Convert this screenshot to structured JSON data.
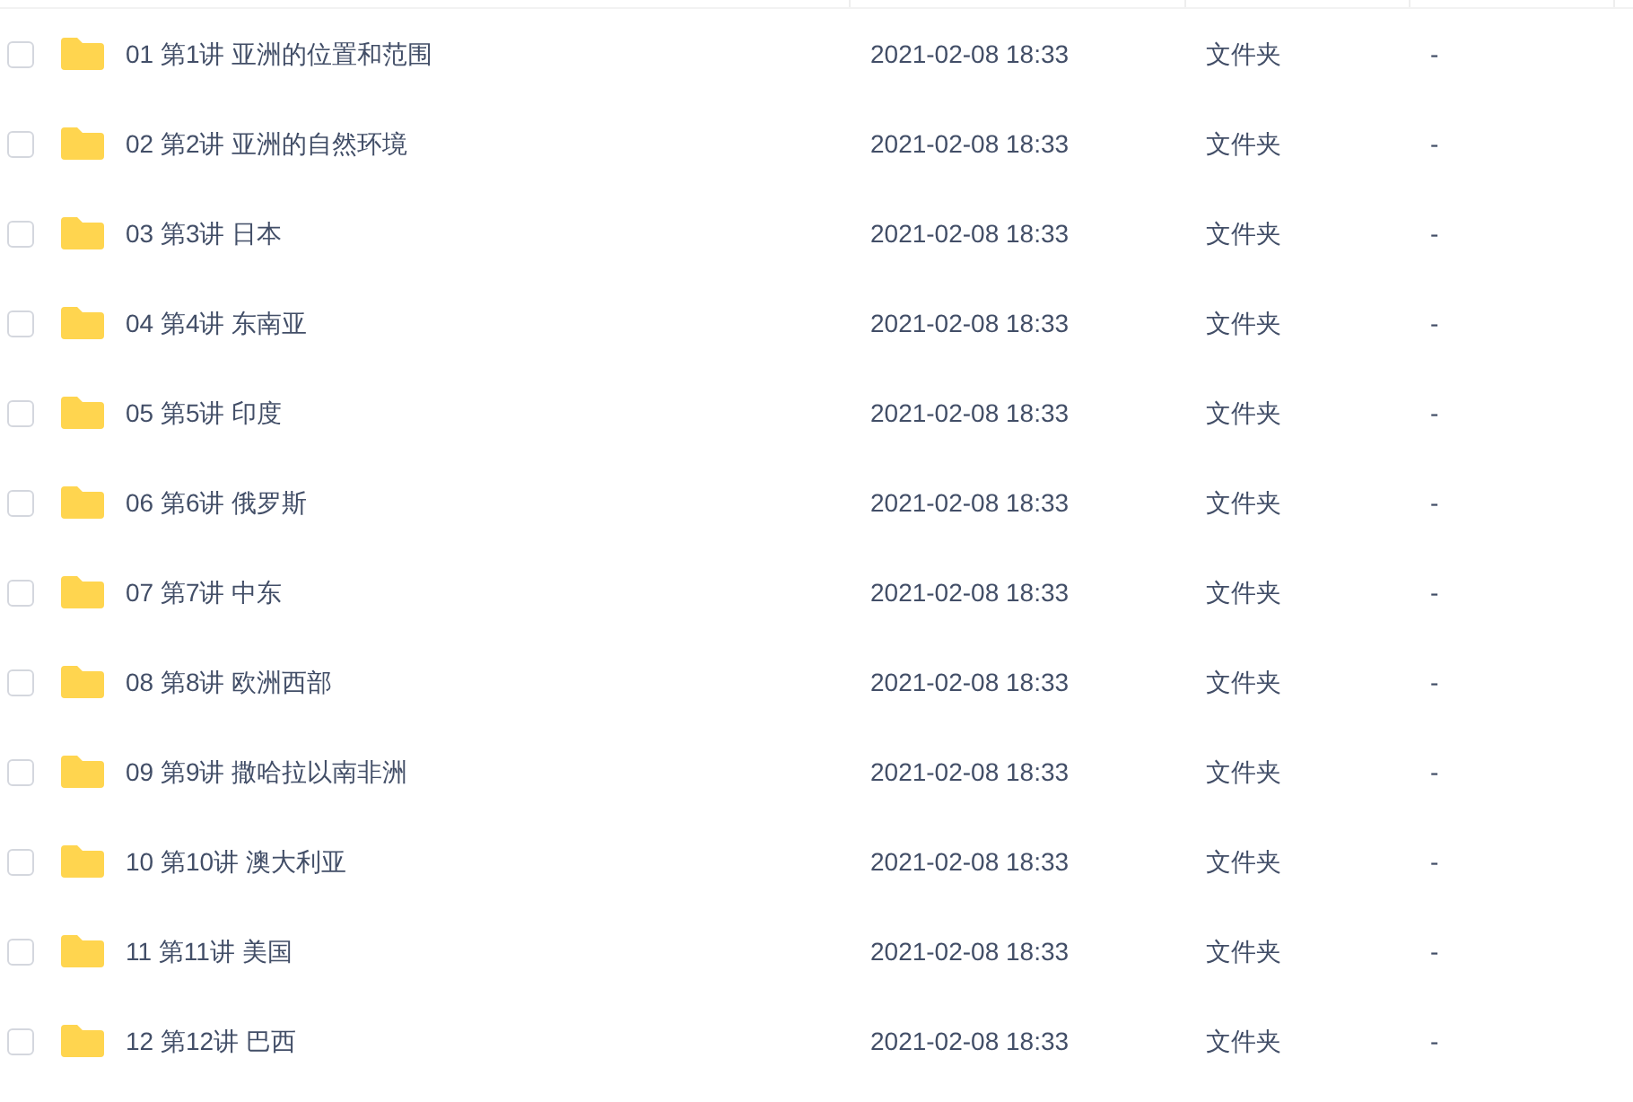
{
  "rows": [
    {
      "name": "01 第1讲 亚洲的位置和范围",
      "modified": "2021-02-08 18:33",
      "type": "文件夹",
      "size": "-",
      "checked": false
    },
    {
      "name": "02 第2讲 亚洲的自然环境",
      "modified": "2021-02-08 18:33",
      "type": "文件夹",
      "size": "-",
      "checked": false
    },
    {
      "name": "03 第3讲 日本",
      "modified": "2021-02-08 18:33",
      "type": "文件夹",
      "size": "-",
      "checked": false
    },
    {
      "name": "04 第4讲 东南亚",
      "modified": "2021-02-08 18:33",
      "type": "文件夹",
      "size": "-",
      "checked": false
    },
    {
      "name": "05 第5讲 印度",
      "modified": "2021-02-08 18:33",
      "type": "文件夹",
      "size": "-",
      "checked": false
    },
    {
      "name": "06 第6讲 俄罗斯",
      "modified": "2021-02-08 18:33",
      "type": "文件夹",
      "size": "-",
      "checked": false
    },
    {
      "name": "07 第7讲 中东",
      "modified": "2021-02-08 18:33",
      "type": "文件夹",
      "size": "-",
      "checked": false
    },
    {
      "name": "08 第8讲 欧洲西部",
      "modified": "2021-02-08 18:33",
      "type": "文件夹",
      "size": "-",
      "checked": false
    },
    {
      "name": "09 第9讲 撒哈拉以南非洲",
      "modified": "2021-02-08 18:33",
      "type": "文件夹",
      "size": "-",
      "checked": false
    },
    {
      "name": "10 第10讲 澳大利亚",
      "modified": "2021-02-08 18:33",
      "type": "文件夹",
      "size": "-",
      "checked": false
    },
    {
      "name": "11 第11讲 美国",
      "modified": "2021-02-08 18:33",
      "type": "文件夹",
      "size": "-",
      "checked": false
    },
    {
      "name": "12 第12讲 巴西",
      "modified": "2021-02-08 18:33",
      "type": "文件夹",
      "size": "-",
      "checked": false
    }
  ]
}
